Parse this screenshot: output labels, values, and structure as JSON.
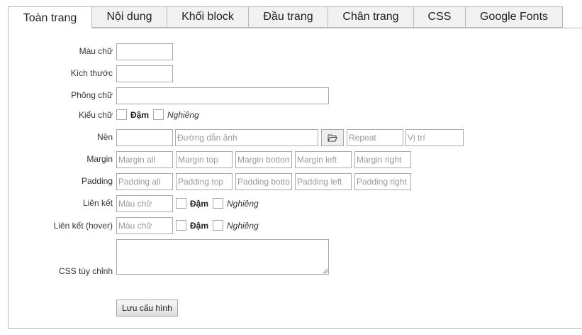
{
  "tabs": [
    "Toàn trang",
    "Nội dung",
    "Khối block",
    "Đầu trang",
    "Chân trang",
    "CSS",
    "Google Fonts"
  ],
  "labels": {
    "text_color": "Màu chữ",
    "font_size": "Kích thước",
    "font_family": "Phông chữ",
    "font_style": "Kiểu chữ",
    "background": "Nền",
    "margin": "Margin",
    "padding": "Padding",
    "link": "Liên kết",
    "link_hover": "Liên kết (hover)",
    "custom_css": "CSS tùy chỉnh"
  },
  "style_options": {
    "bold": "Đậm",
    "italic": "Nghiêng"
  },
  "placeholders": {
    "bg_image": "Đường dẫn ảnh",
    "bg_repeat": "Repeat",
    "bg_position": "Vị trí",
    "margin_all": "Margin all",
    "margin_top": "Margin top",
    "margin_bottom": "Margin bottom",
    "margin_left": "Margin left",
    "margin_right": "Margin right",
    "padding_all": "Padding all",
    "padding_top": "Padding top",
    "padding_bottom": "Padding bottom",
    "padding_left": "Padding left",
    "padding_right": "Padding right",
    "link_color": "Màu chữ",
    "link_hover_color": "Màu chữ"
  },
  "save_label": "Lưu cấu hình",
  "icons": {
    "browse": "folder-open-icon"
  }
}
